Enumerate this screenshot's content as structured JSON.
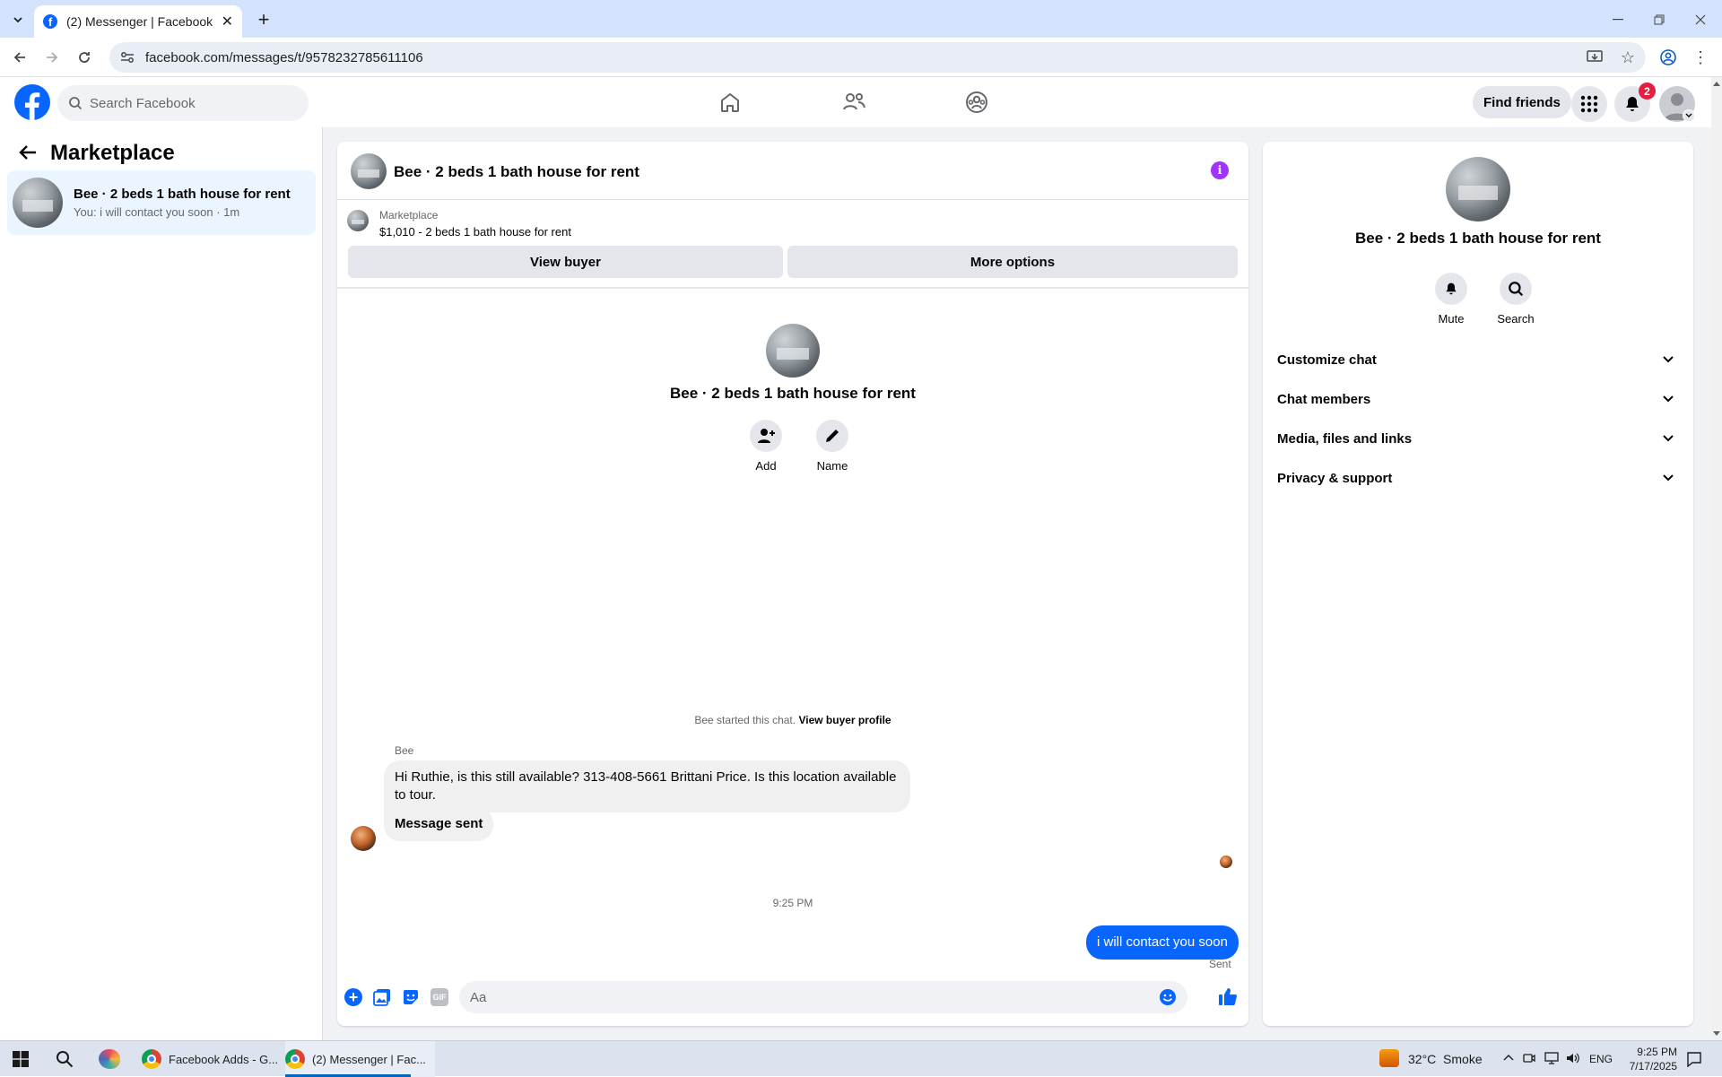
{
  "browser": {
    "tab_title": "(2) Messenger | Facebook",
    "url": "facebook.com/messages/t/9578232785611106"
  },
  "fb_header": {
    "search_placeholder": "Search Facebook",
    "find_friends": "Find friends",
    "notification_count": "2",
    "brand_color": "#0866ff"
  },
  "sidebar": {
    "title": "Marketplace",
    "conversations": [
      {
        "name": "Bee · 2 beds 1 bath house for rent",
        "preview": "You: i will contact you soon · 1m"
      }
    ]
  },
  "chat": {
    "title": "Bee · 2 beds 1 bath house for rent",
    "listing": {
      "label": "Marketplace",
      "detail": "$1,010 - 2 beds 1 bath house for rent"
    },
    "view_buyer": "View buyer",
    "more_options": "More options",
    "intro_name": "Bee · 2 beds 1 bath house for rent",
    "intro_actions": {
      "add": "Add",
      "name": "Name"
    },
    "started_text": "Bee started this chat.",
    "view_buyer_profile": "View buyer profile",
    "sender_name": "Bee",
    "incoming_message": "Hi Ruthie, is this still available? 313-408-5661 Brittani Price. Is this location available to tour.",
    "incoming_message_2": "Message sent",
    "timestamp": "9:25 PM",
    "outgoing_message": "i will contact you soon",
    "outgoing_status": "Sent",
    "composer_placeholder": "Aa",
    "gif_label": "GIF"
  },
  "details_panel": {
    "title": "Bee · 2 beds 1 bath house for rent",
    "mute": "Mute",
    "search": "Search",
    "sections": [
      "Customize chat",
      "Chat members",
      "Media, files and links",
      "Privacy & support"
    ]
  },
  "taskbar": {
    "apps": [
      "Facebook Adds - G...",
      "(2) Messenger | Fac..."
    ],
    "weather": "32°C  Smoke",
    "lang": "ENG",
    "time": "9:25 PM",
    "date": "7/17/2025"
  }
}
